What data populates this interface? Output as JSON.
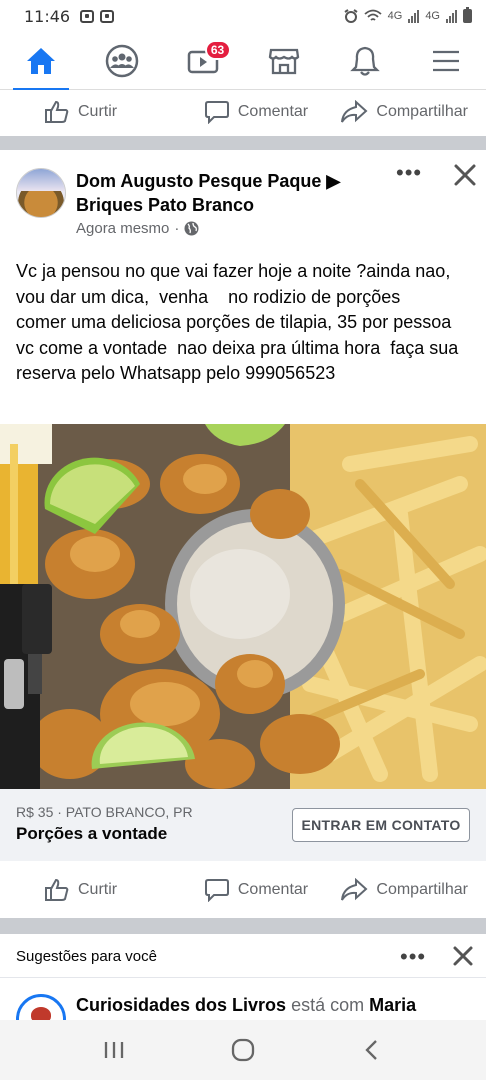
{
  "status": {
    "time": "11:46",
    "net1": "4G",
    "net2": "4G"
  },
  "nav": {
    "items": [
      {
        "name": "home",
        "icon": "home-icon",
        "active": true
      },
      {
        "name": "groups",
        "icon": "groups-icon"
      },
      {
        "name": "watch",
        "icon": "video-icon",
        "badge": "63"
      },
      {
        "name": "marketplace",
        "icon": "store-icon"
      },
      {
        "name": "notifications",
        "icon": "bell-icon"
      },
      {
        "name": "menu",
        "icon": "hamburger-icon"
      }
    ],
    "accent": "#1877f2",
    "badge_color": "#e41e3f"
  },
  "actions": {
    "like": "Curtir",
    "comment": "Comentar",
    "share": "Compartilhar"
  },
  "post": {
    "page_name": "Dom Augusto Pesque Paque ▶ Briques Pato Branco",
    "time": "Agora mesmo",
    "separator": "·",
    "text": "Vc ja pensou no que vai fazer hoje a noite ?ainda nao, vou dar um dica,  venha    no rodizio de porções    comer uma deliciosa porções de tilapia, 35 por pessoa  vc come a vontade  nao deixa pra última hora  faça sua reserva pelo Whatsapp pelo 999056523"
  },
  "listing": {
    "meta": "R$ 35 · PATO BRANCO, PR",
    "title": "Porções  a vontade",
    "cta": "ENTRAR EM CONTATO"
  },
  "suggestions": {
    "title": "Sugestões para você",
    "item_page": "Curiosidades dos Livros",
    "item_mid": " está com ",
    "item_person": "Maria"
  }
}
